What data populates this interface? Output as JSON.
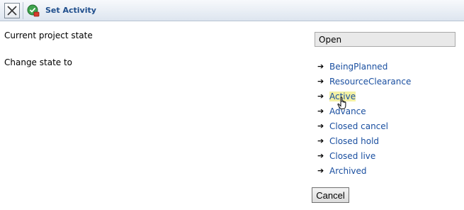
{
  "window": {
    "title": "Set Activity"
  },
  "form": {
    "current_state_label": "Current project state",
    "current_state_value": "Open",
    "change_state_label": "Change state to"
  },
  "states": [
    {
      "label": "BeingPlanned"
    },
    {
      "label": "ResourceClearance"
    },
    {
      "label": "Active"
    },
    {
      "label": "Advance"
    },
    {
      "label": "Closed cancel"
    },
    {
      "label": "Closed hold"
    },
    {
      "label": "Closed live"
    },
    {
      "label": "Archived"
    }
  ],
  "buttons": {
    "cancel": "Cancel"
  },
  "icons": {
    "close": "close-icon",
    "app": "set-activity-icon",
    "bullet": "right-arrow-icon",
    "cursor": "hand-pointer-icon"
  },
  "colors": {
    "link": "#1a4fa0",
    "title": "#1f4e8c",
    "hover_highlight": "#f4f1a4"
  }
}
